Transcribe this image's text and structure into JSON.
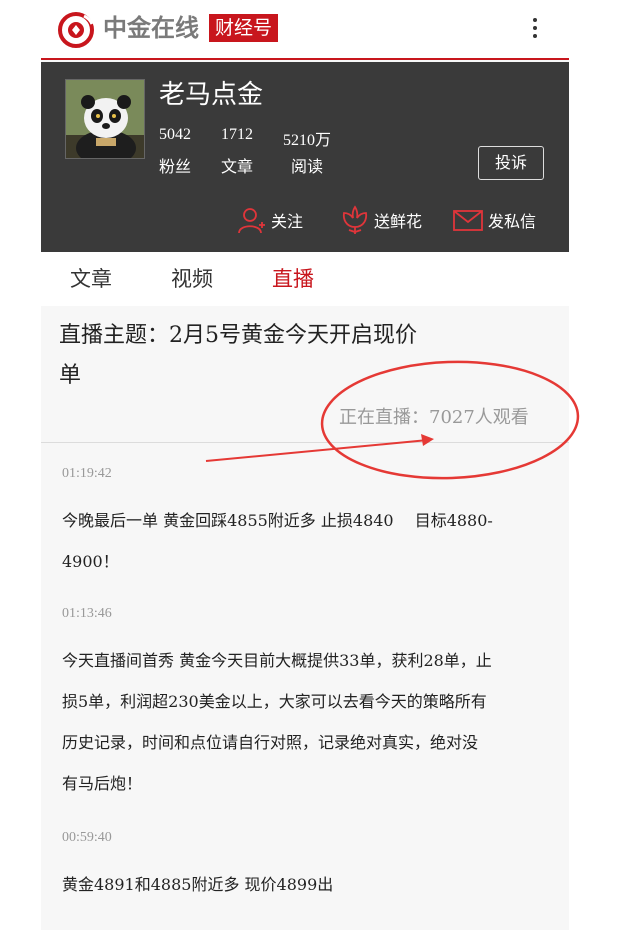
{
  "header": {
    "logo_text": "中金在线",
    "logo_badge": "财经号",
    "logo_icon": "zhongjin-logo-icon",
    "more_icon": "more-vertical-icon"
  },
  "profile": {
    "name": "老马点金",
    "stats": [
      {
        "value": "5042",
        "label": "粉丝"
      },
      {
        "value": "1712",
        "label": "文章"
      },
      {
        "value": "5210万",
        "label": "阅读"
      }
    ],
    "report_label": "投诉",
    "actions": [
      {
        "label": "关注",
        "icon": "user-add-icon"
      },
      {
        "label": "送鲜花",
        "icon": "flower-icon"
      },
      {
        "label": "发私信",
        "icon": "mail-icon"
      }
    ]
  },
  "tabs": [
    {
      "label": "文章",
      "active": false
    },
    {
      "label": "视频",
      "active": false
    },
    {
      "label": "直播",
      "active": true
    }
  ],
  "live": {
    "title_line1": "直播主题：2月5号黄金今天开启现价",
    "title_line2": "单",
    "viewers": "正在直播：7027人观看"
  },
  "entries": [
    {
      "time": "01:19:42",
      "lines": [
        "今晚最后一单 黄金回踩4855附近多 止损4840　 目标4880-",
        "4900！"
      ]
    },
    {
      "time": "01:13:46",
      "lines": [
        "今天直播间首秀 黄金今天目前大概提供33单，获利28单，止",
        "损5单，利润超230美金以上，大家可以去看今天的策略所有",
        "历史记录，时间和点位请自行对照，记录绝对真实，绝对没",
        "有马后炮！"
      ]
    },
    {
      "time": "00:59:40",
      "lines": [
        "黄金4891和4885附近多 现价4899出"
      ]
    }
  ],
  "colors": {
    "brand_red": "#c8161d",
    "profile_bg": "#3a3a3a",
    "annotation_red": "#e53935"
  }
}
